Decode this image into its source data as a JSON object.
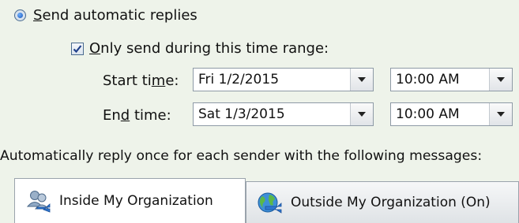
{
  "auto_reply": {
    "send_label_first": "S",
    "send_label_rest": "end automatic replies",
    "send_selected": true
  },
  "time_range": {
    "checkbox_label_first": "O",
    "checkbox_label_rest": "nly send during this time range:",
    "checked": true,
    "start_label_pre": "Start ti",
    "start_label_u": "m",
    "start_label_post": "e:",
    "end_label_pre": "En",
    "end_label_u": "d",
    "end_label_post": " time:",
    "start_date": "Fri 1/2/2015",
    "start_time": "10:00 AM",
    "end_date": "Sat 1/3/2015",
    "end_time": "10:00 AM"
  },
  "messages_caption": "Automatically reply once for each sender with the following messages:",
  "tabs": [
    {
      "label": "Inside My Organization",
      "icon": "people-icon",
      "active": true
    },
    {
      "label": "Outside My Organization (On)",
      "icon": "globe-icon",
      "active": false
    }
  ]
}
